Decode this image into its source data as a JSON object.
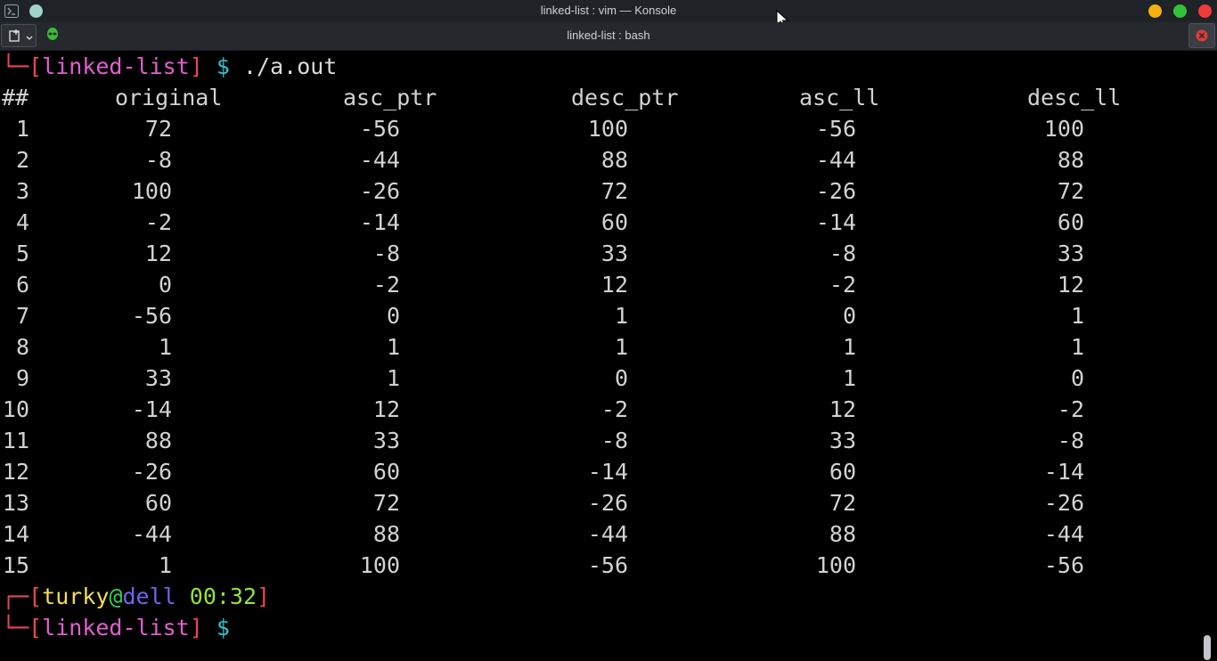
{
  "window": {
    "title": "linked-list : vim — Konsole",
    "buttons": {
      "minimize": "minimize",
      "maximize": "maximize",
      "close": "close"
    }
  },
  "tab": {
    "title": "linked-list : bash",
    "icon": "alien-icon"
  },
  "terminal": {
    "prev_prompt": {
      "corner": "└─",
      "open": "[",
      "dir": "linked-list",
      "close": "]",
      "dollar": "$",
      "command": "./a.out"
    },
    "headers": [
      "##",
      "original",
      "asc_ptr",
      "desc_ptr",
      "asc_ll",
      "desc_ll"
    ],
    "rows": [
      [
        "1",
        "72",
        "-56",
        "100",
        "-56",
        "100"
      ],
      [
        "2",
        "-8",
        "-44",
        "88",
        "-44",
        "88"
      ],
      [
        "3",
        "100",
        "-26",
        "72",
        "-26",
        "72"
      ],
      [
        "4",
        "-2",
        "-14",
        "60",
        "-14",
        "60"
      ],
      [
        "5",
        "12",
        "-8",
        "33",
        "-8",
        "33"
      ],
      [
        "6",
        "0",
        "-2",
        "12",
        "-2",
        "12"
      ],
      [
        "7",
        "-56",
        "0",
        "1",
        "0",
        "1"
      ],
      [
        "8",
        "1",
        "1",
        "1",
        "1",
        "1"
      ],
      [
        "9",
        "33",
        "1",
        "0",
        "1",
        "0"
      ],
      [
        "10",
        "-14",
        "12",
        "-2",
        "12",
        "-2"
      ],
      [
        "11",
        "88",
        "33",
        "-8",
        "33",
        "-8"
      ],
      [
        "12",
        "-26",
        "60",
        "-14",
        "60",
        "-14"
      ],
      [
        "13",
        "60",
        "72",
        "-26",
        "72",
        "-26"
      ],
      [
        "14",
        "-44",
        "88",
        "-44",
        "88",
        "-44"
      ],
      [
        "15",
        "1",
        "100",
        "-56",
        "100",
        "-56"
      ]
    ],
    "prompt": {
      "corner_top": "┌─",
      "open": "[",
      "user": "turky",
      "at": "@",
      "host": "dell",
      "time": "00:32",
      "close": "]",
      "corner_bottom": "└─",
      "dir": "linked-list",
      "dollar": "$"
    }
  },
  "colors": {
    "bracket": "#ee4455",
    "dir": "#e25fd0",
    "dollar": "#29c4d2",
    "user": "#f1e04e",
    "at": "#2fd35a",
    "host": "#6b66f0",
    "time": "#8ce83a"
  }
}
